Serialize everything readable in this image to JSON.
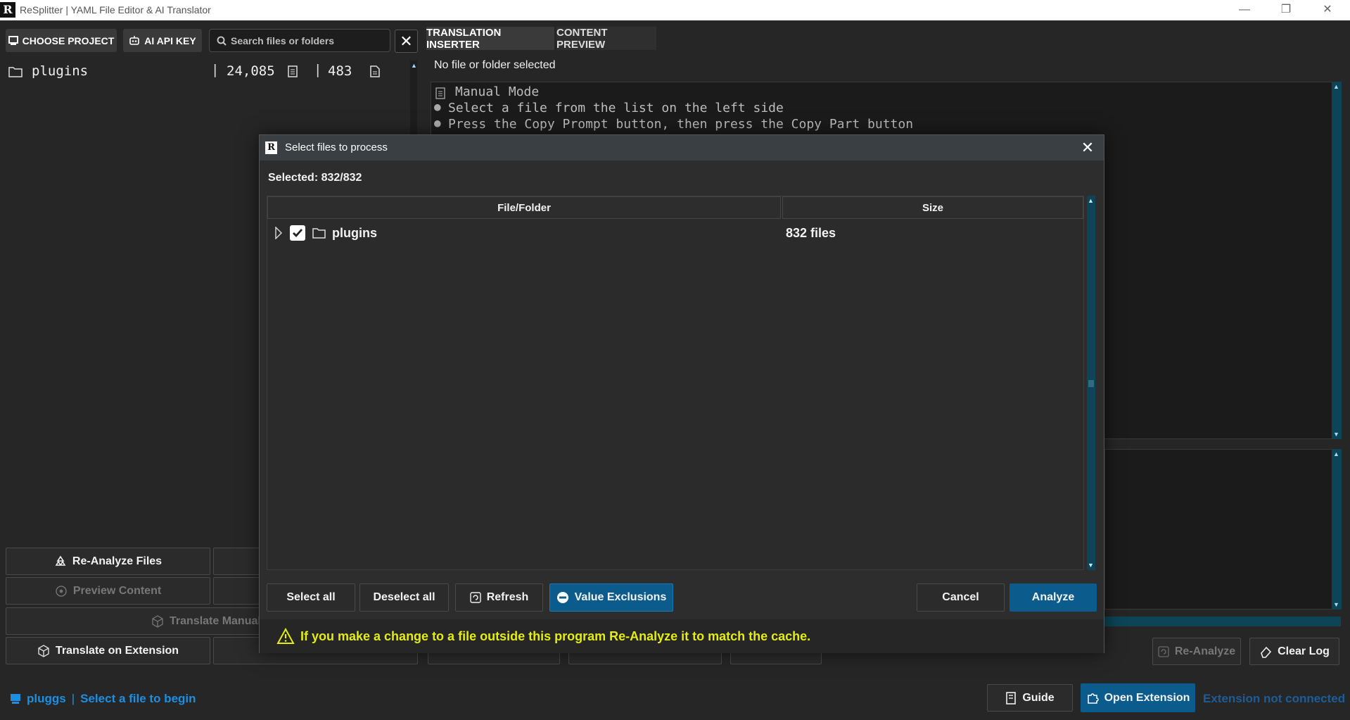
{
  "window": {
    "title": "ReSplitter | YAML File Editor & AI Translator",
    "logo": "R"
  },
  "toolbar": {
    "choose_project": "CHOOSE PROJECT",
    "ai_api_key": "AI API KEY",
    "search_placeholder": "Search files or folders",
    "clear_symbol": "✕"
  },
  "tree": {
    "name": "plugins",
    "lines": "24,085",
    "files": "483"
  },
  "tabs": [
    "TRANSLATION INSERTER",
    "CONTENT PREVIEW"
  ],
  "editor": {
    "status": "No file or folder selected",
    "lines": [
      "Manual Mode",
      "Select a file from the list on the left side",
      "Press the Copy Prompt button, then press the Copy Part button"
    ]
  },
  "left_buttons": {
    "reanalyze_files": "Re-Analyze Files",
    "preview_content": "Preview Content",
    "translate_manual": "Translate Manual",
    "translate_extension": "Translate on Extension"
  },
  "right_buttons": {
    "reanalyze": "Re-Analyze",
    "clear_log": "Clear Log"
  },
  "status_bar": {
    "project": "pluggs",
    "separator": "|",
    "message": "Select a file to begin",
    "guide": "Guide",
    "open_extension": "Open Extension",
    "extension_status": "Extension not connected"
  },
  "dialog": {
    "title": "Select files to process",
    "selected": "Selected: 832/832",
    "columns": [
      "File/Folder",
      "Size"
    ],
    "rows": [
      {
        "name": "plugins",
        "size": "832 files",
        "checked": true
      }
    ],
    "buttons": {
      "select_all": "Select all",
      "deselect_all": "Deselect all",
      "refresh": "Refresh",
      "value_exclusions": "Value Exclusions",
      "cancel": "Cancel",
      "analyze": "Analyze"
    },
    "warning": "If you make a change to a file outside this program Re-Analyze it to match the cache."
  },
  "colors": {
    "accent": "#0b5c8c",
    "warning": "#e4ed12",
    "link": "#1e8fe0",
    "background": "#262626"
  }
}
